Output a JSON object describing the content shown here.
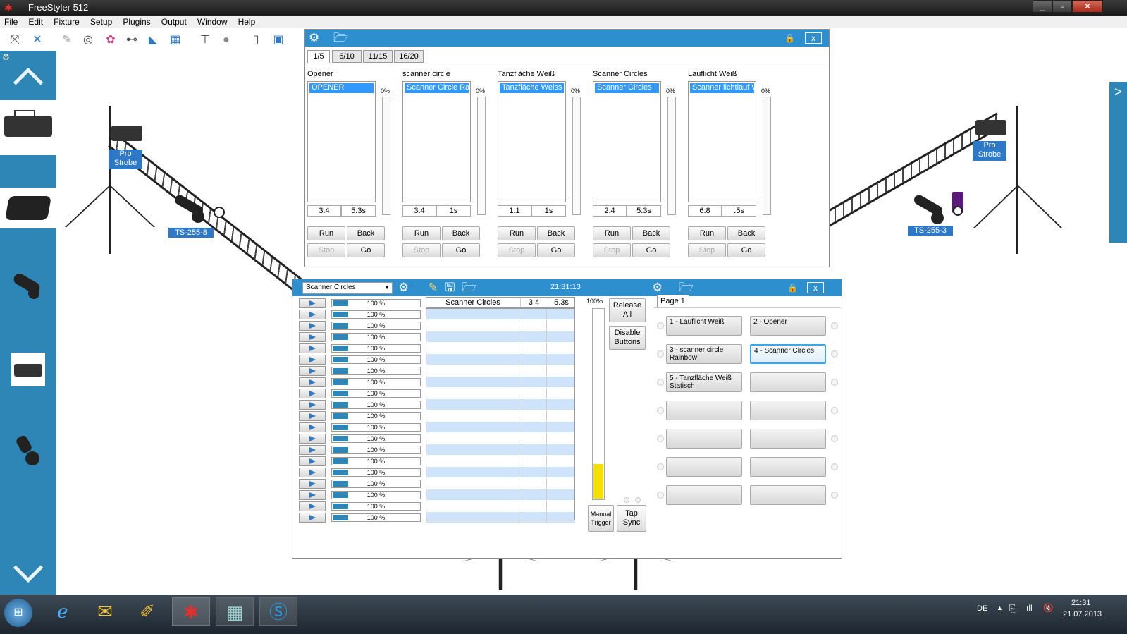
{
  "app": {
    "title": "FreeStyler 512",
    "win_min": "_",
    "win_max": "▫",
    "win_close": "✕"
  },
  "menu": [
    "File",
    "Edit",
    "Fixture",
    "Setup",
    "Plugins",
    "Output",
    "Window",
    "Help"
  ],
  "fixture_labels": [
    "Pro\nStrobe",
    "TS-255-8",
    "Pro\nStrobe",
    "TS-255-3"
  ],
  "sidebar": {
    "up_icon": "chevron-up-icon",
    "down_icon": "chevron-down-icon",
    "right_arrow": ">"
  },
  "cue_window": {
    "tabs": [
      "1/5",
      "6/10",
      "11/15",
      "16/20"
    ],
    "lock": "🔒",
    "close": "x",
    "cues": [
      {
        "title": "Opener",
        "item": "OPENER",
        "pct": "0%",
        "step": "3:4",
        "time": "5.3s"
      },
      {
        "title": "scanner circle",
        "item": "Scanner Circle Rai",
        "pct": "0%",
        "step": "3:4",
        "time": "1s"
      },
      {
        "title": "Tanzfläche Weiß",
        "item": "Tanzfläche Weiss S",
        "pct": "0%",
        "step": "1:1",
        "time": "1s"
      },
      {
        "title": "Scanner Circles",
        "item": "Scanner Circles",
        "pct": "0%",
        "step": "2:4",
        "time": "5.3s"
      },
      {
        "title": "Lauflicht Weiß",
        "item": "Scanner lichtlauf W",
        "pct": "0%",
        "step": "6:8",
        "time": ".5s"
      }
    ],
    "buttons": {
      "run": "Run",
      "back": "Back",
      "stop": "Stop",
      "go": "Go"
    }
  },
  "sequence_window": {
    "select_value": "Scanner Circles",
    "time": "21:31:13",
    "lock": "🔒",
    "close": "x",
    "row_level": "100 %",
    "grid_header": {
      "name": "Scanner Circles",
      "step": "3:4",
      "time": "5.3s"
    },
    "master_pct": "100%",
    "master_level": 0.18,
    "release_all": "Release\nAll",
    "disable_buttons": "Disable\nButtons",
    "manual_trigger": "Manual\nTrigger",
    "tap_sync": "Tap\nSync",
    "page_tab": "Page 1",
    "page_buttons": [
      "1 - Lauflicht Weiß",
      "2 - Opener",
      "3 - scanner circle\nRainbow",
      "4 - Scanner Circles",
      "5 - Tanzfläche Weiß\nStatisch",
      "",
      "",
      "",
      "",
      "",
      "",
      "",
      "",
      ""
    ]
  },
  "taskbar": {
    "lang": "DE",
    "clock_time": "21:31",
    "clock_date": "21.07.2013"
  }
}
